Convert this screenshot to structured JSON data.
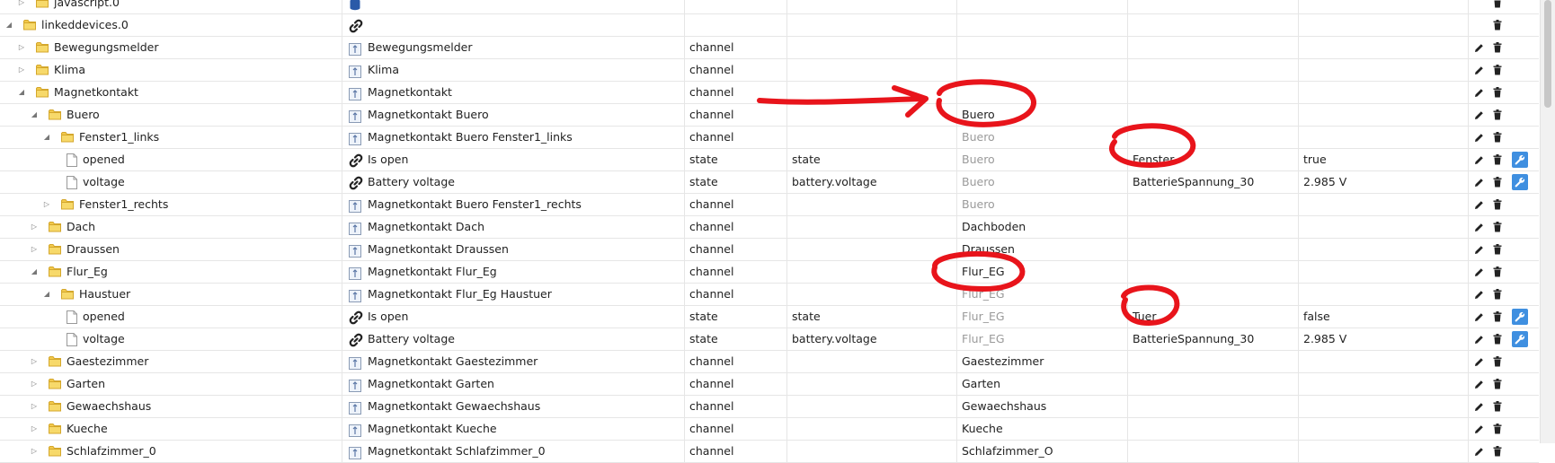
{
  "rows": [
    {
      "level": 1,
      "kind": "folder",
      "expander": "collapsed",
      "id": "javascript.0",
      "name_icon": "database-icon",
      "name": "",
      "type": "",
      "role": "",
      "room": "",
      "function": "",
      "value": "",
      "actions": "delete"
    },
    {
      "level": 0,
      "kind": "folder",
      "expander": "expanded",
      "id": "linkeddevices.0",
      "name_icon": "link-icon",
      "name": "",
      "type": "",
      "role": "",
      "room": "",
      "function": "",
      "value": "",
      "actions": "delete"
    },
    {
      "level": 1,
      "kind": "folder",
      "expander": "collapsed",
      "id": "Bewegungsmelder",
      "name_icon": "channel-icon",
      "name": "Bewegungsmelder",
      "type": "channel",
      "role": "",
      "room": "",
      "function": "",
      "value": "",
      "actions": "edit-delete"
    },
    {
      "level": 1,
      "kind": "folder",
      "expander": "collapsed",
      "id": "Klima",
      "name_icon": "channel-icon",
      "name": "Klima",
      "type": "channel",
      "role": "",
      "room": "",
      "function": "",
      "value": "",
      "actions": "edit-delete"
    },
    {
      "level": 1,
      "kind": "folder",
      "expander": "expanded",
      "id": "Magnetkontakt",
      "name_icon": "channel-icon",
      "name": "Magnetkontakt",
      "type": "channel",
      "role": "",
      "room": "",
      "function": "",
      "value": "",
      "actions": "edit-delete"
    },
    {
      "level": 2,
      "kind": "folder",
      "expander": "expanded",
      "id": "Buero",
      "name_icon": "channel-icon",
      "name": "Magnetkontakt Buero",
      "type": "channel",
      "role": "",
      "room": "Buero",
      "room_muted": false,
      "function": "",
      "value": "",
      "actions": "edit-delete"
    },
    {
      "level": 3,
      "kind": "folder",
      "expander": "expanded",
      "id": "Fenster1_links",
      "name_icon": "channel-icon",
      "name": "Magnetkontakt Buero Fenster1_links",
      "type": "channel",
      "role": "",
      "room": "Buero",
      "room_muted": true,
      "function": "",
      "value": "",
      "actions": "edit-delete"
    },
    {
      "level": 4,
      "kind": "file",
      "expander": "none",
      "id": "opened",
      "name_icon": "link-icon",
      "name": "Is open",
      "type": "state",
      "role": "state",
      "room": "Buero",
      "room_muted": true,
      "function": "Fenster",
      "value": "true",
      "actions": "edit-delete-wrench"
    },
    {
      "level": 4,
      "kind": "file",
      "expander": "none",
      "id": "voltage",
      "name_icon": "link-icon",
      "name": "Battery voltage",
      "type": "state",
      "role": "battery.voltage",
      "room": "Buero",
      "room_muted": true,
      "function": "BatterieSpannung_30",
      "value": "2.985 V",
      "actions": "edit-delete-wrench"
    },
    {
      "level": 3,
      "kind": "folder",
      "expander": "collapsed",
      "id": "Fenster1_rechts",
      "name_icon": "channel-icon",
      "name": "Magnetkontakt Buero Fenster1_rechts",
      "type": "channel",
      "role": "",
      "room": "Buero",
      "room_muted": true,
      "function": "",
      "value": "",
      "actions": "edit-delete"
    },
    {
      "level": 2,
      "kind": "folder",
      "expander": "collapsed",
      "id": "Dach",
      "name_icon": "channel-icon",
      "name": "Magnetkontakt Dach",
      "type": "channel",
      "role": "",
      "room": "Dachboden",
      "room_muted": false,
      "function": "",
      "value": "",
      "actions": "edit-delete"
    },
    {
      "level": 2,
      "kind": "folder",
      "expander": "collapsed",
      "id": "Draussen",
      "name_icon": "channel-icon",
      "name": "Magnetkontakt Draussen",
      "type": "channel",
      "role": "",
      "room": "Draussen",
      "room_muted": false,
      "function": "",
      "value": "",
      "actions": "edit-delete"
    },
    {
      "level": 2,
      "kind": "folder",
      "expander": "expanded",
      "id": "Flur_Eg",
      "name_icon": "channel-icon",
      "name": "Magnetkontakt Flur_Eg",
      "type": "channel",
      "role": "",
      "room": "Flur_EG",
      "room_muted": false,
      "function": "",
      "value": "",
      "actions": "edit-delete"
    },
    {
      "level": 3,
      "kind": "folder",
      "expander": "expanded",
      "id": "Haustuer",
      "name_icon": "channel-icon",
      "name": "Magnetkontakt Flur_Eg Haustuer",
      "type": "channel",
      "role": "",
      "room": "Flur_EG",
      "room_muted": true,
      "function": "",
      "value": "",
      "actions": "edit-delete"
    },
    {
      "level": 4,
      "kind": "file",
      "expander": "none",
      "id": "opened",
      "name_icon": "link-icon",
      "name": "Is open",
      "type": "state",
      "role": "state",
      "room": "Flur_EG",
      "room_muted": true,
      "function": "Tuer",
      "value": "false",
      "actions": "edit-delete-wrench"
    },
    {
      "level": 4,
      "kind": "file",
      "expander": "none",
      "id": "voltage",
      "name_icon": "link-icon",
      "name": "Battery voltage",
      "type": "state",
      "role": "battery.voltage",
      "room": "Flur_EG",
      "room_muted": true,
      "function": "BatterieSpannung_30",
      "value": "2.985 V",
      "actions": "edit-delete-wrench"
    },
    {
      "level": 2,
      "kind": "folder",
      "expander": "collapsed",
      "id": "Gaestezimmer",
      "name_icon": "channel-icon",
      "name": "Magnetkontakt Gaestezimmer",
      "type": "channel",
      "role": "",
      "room": "Gaestezimmer",
      "room_muted": false,
      "function": "",
      "value": "",
      "actions": "edit-delete"
    },
    {
      "level": 2,
      "kind": "folder",
      "expander": "collapsed",
      "id": "Garten",
      "name_icon": "channel-icon",
      "name": "Magnetkontakt Garten",
      "type": "channel",
      "role": "",
      "room": "Garten",
      "room_muted": false,
      "function": "",
      "value": "",
      "actions": "edit-delete"
    },
    {
      "level": 2,
      "kind": "folder",
      "expander": "collapsed",
      "id": "Gewaechshaus",
      "name_icon": "channel-icon",
      "name": "Magnetkontakt Gewaechshaus",
      "type": "channel",
      "role": "",
      "room": "Gewaechshaus",
      "room_muted": false,
      "function": "",
      "value": "",
      "actions": "edit-delete"
    },
    {
      "level": 2,
      "kind": "folder",
      "expander": "collapsed",
      "id": "Kueche",
      "name_icon": "channel-icon",
      "name": "Magnetkontakt Kueche",
      "type": "channel",
      "role": "",
      "room": "Kueche",
      "room_muted": false,
      "function": "",
      "value": "",
      "actions": "edit-delete"
    },
    {
      "level": 2,
      "kind": "folder",
      "expander": "collapsed",
      "id": "Schlafzimmer_0",
      "name_icon": "channel-icon",
      "name": "Magnetkontakt Schlafzimmer_0",
      "type": "channel",
      "role": "",
      "room": "Schlafzimmer_O",
      "room_muted": false,
      "function": "",
      "value": "",
      "actions": "edit-delete"
    }
  ],
  "annotation_color": "#e8141b",
  "icons": {
    "edit": "pencil-icon",
    "delete": "trash-icon",
    "settings": "wrench-icon",
    "folder": "folder-icon",
    "file": "file-icon"
  }
}
